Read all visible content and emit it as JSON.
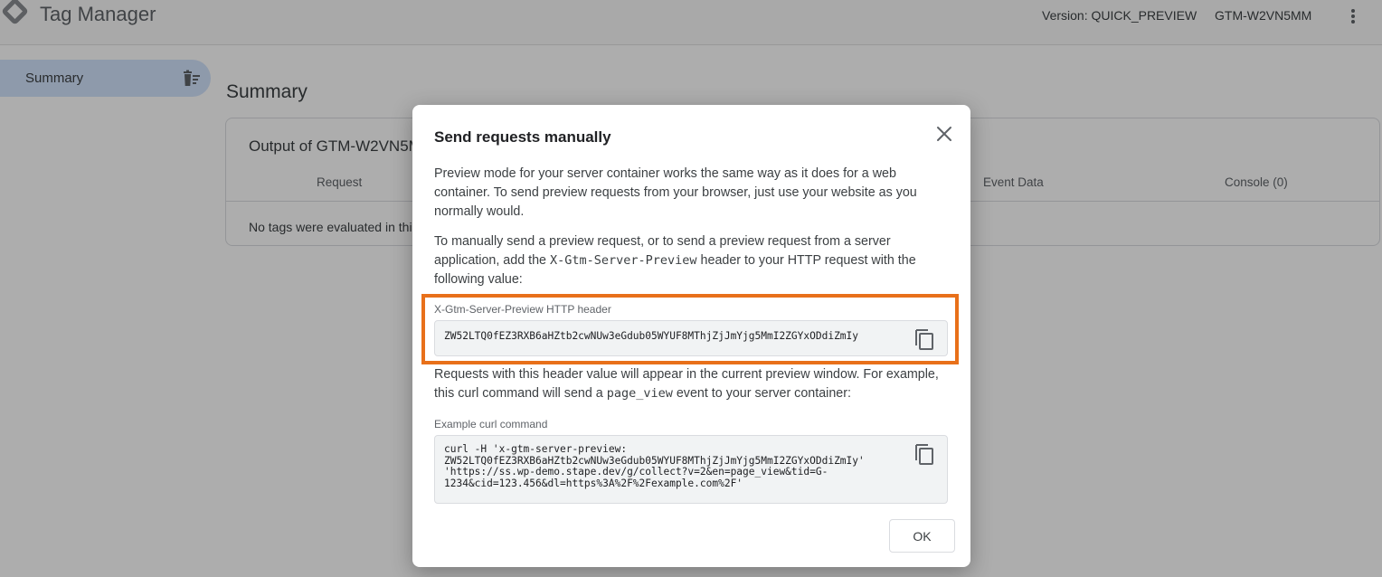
{
  "app": {
    "title": "Tag Manager",
    "version": "Version: QUICK_PREVIEW",
    "container_id": "GTM-W2VN5MM"
  },
  "sidebar": {
    "items": [
      {
        "label": "Summary"
      }
    ]
  },
  "main": {
    "page_title": "Summary",
    "card": {
      "title": "Output of GTM-W2VN5MM",
      "columns": [
        "Request",
        "Event Data",
        "Console (0)"
      ],
      "empty_message": "No tags were evaluated in this request."
    }
  },
  "dialog": {
    "title": "Send requests manually",
    "para1": "Preview mode for your server container works the same way as it does for a web container. To send preview requests from your browser, just use your website as you normally would.",
    "para2_prefix": "To manually send a preview request, or to send a preview request from a server application, add the",
    "para2_code": "X-Gtm-Server-Preview",
    "para2_suffix": "header to your HTTP request with the following value:",
    "header_label": "X-Gtm-Server-Preview HTTP header",
    "header_value": "ZW52LTQ0fEZ3RXB6aHZtb2cwNUw3eGdub05WYUF8MThjZjJmYjg5MmI2ZGYxODdiZmIy",
    "para3_prefix": "Requests with this header value will appear in the current preview window. For example, this curl command will send a",
    "para3_code": "page_view",
    "para3_suffix": "event to your server container:",
    "curl_label": "Example curl command",
    "curl_lines": [
      "curl -H 'x-gtm-server-preview:",
      "ZW52LTQ0fEZ3RXB6aHZtb2cwNUw3eGdub05WYUF8MThjZjJmYjg5MmI2ZGYxODdiZmIy'",
      "'https://ss.wp-demo.stape.dev/g/collect?v=2&en=page_view&tid=G-",
      "1234&cid=123.456&dl=https%3A%2F%2Fexample.com%2F'"
    ],
    "ok_label": "OK"
  },
  "icons": {
    "logo": "tag-manager-logo",
    "more": "more-vert-icon",
    "delete": "delete-sweep-icon",
    "close": "close-icon",
    "copy": "copy-icon"
  },
  "colors": {
    "highlight": "#e8701a",
    "sidebar_active": "#d2e3fc"
  }
}
